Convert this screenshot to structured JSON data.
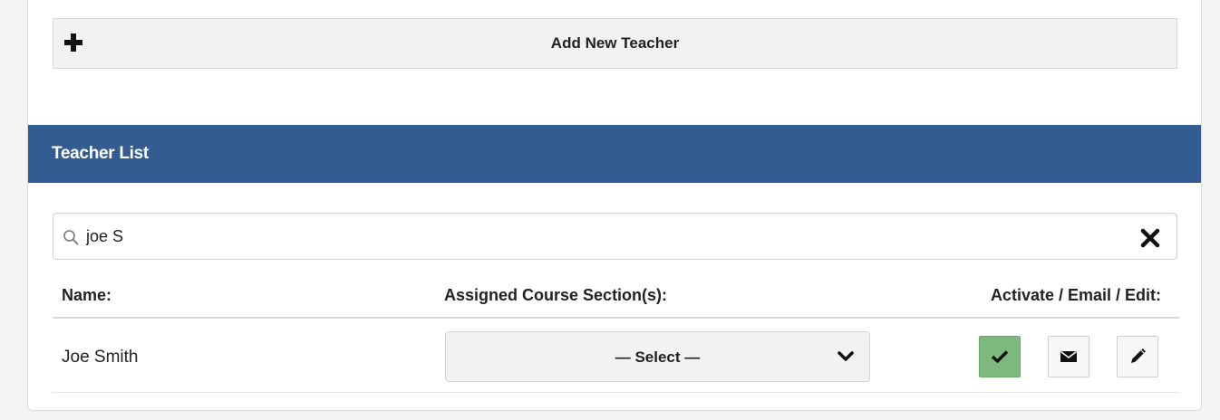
{
  "add_teacher": {
    "label": "Add New Teacher",
    "icon": "plus-icon"
  },
  "teacher_list": {
    "title": "Teacher List",
    "header_color": "#335d91",
    "search": {
      "value": "joe S",
      "icon": "search-icon",
      "clear_icon": "close-icon"
    },
    "columns": {
      "name": "Name:",
      "sections": "Assigned Course Section(s):",
      "actions": "Activate / Email / Edit:"
    },
    "rows": [
      {
        "name": "Joe Smith",
        "section_select": "— Select —",
        "actions": [
          {
            "name": "activate",
            "icon": "check-icon",
            "color": "#7db97d",
            "active": true
          },
          {
            "name": "email",
            "icon": "envelope-icon"
          },
          {
            "name": "edit",
            "icon": "pencil-icon"
          }
        ]
      }
    ]
  }
}
